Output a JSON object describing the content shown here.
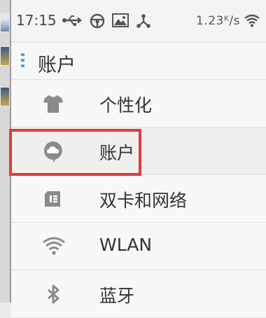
{
  "status_bar": {
    "time": "17:15",
    "net_speed": "1.23ᴷ/s",
    "icons": [
      "usb-icon",
      "steering-wheel-icon",
      "gallery-icon",
      "share-icon",
      "wifi-icon"
    ]
  },
  "header": {
    "title": "账户"
  },
  "settings": {
    "items": [
      {
        "label": "个性化",
        "icon": "tshirt-icon"
      },
      {
        "label": "账户",
        "icon": "cloud-account-icon"
      },
      {
        "label": "双卡和网络",
        "icon": "sim-card-icon"
      },
      {
        "label": "WLAN",
        "icon": "wifi-icon"
      },
      {
        "label": "蓝牙",
        "icon": "bluetooth-icon"
      }
    ]
  },
  "colors": {
    "accent": "#42a5dc",
    "highlight": "#e23c3c",
    "icon_gray": "#8a8a8a"
  }
}
